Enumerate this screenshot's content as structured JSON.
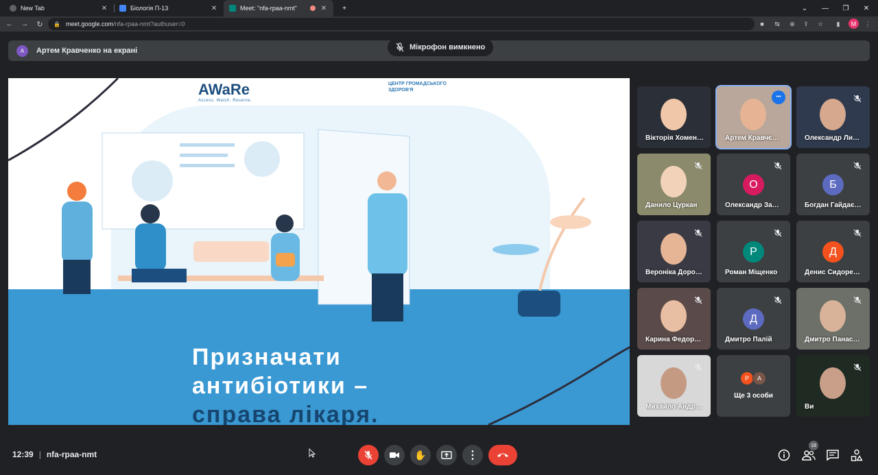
{
  "browser": {
    "tabs": [
      {
        "title": "New Tab",
        "active": false,
        "favicon_color": "#5f6368"
      },
      {
        "title": "Біологія П-13",
        "active": false,
        "favicon_color": "#4285f4"
      },
      {
        "title": "Meet: \"nfa-rpaa-nmt\"",
        "active": true,
        "favicon_color": "#00897b"
      }
    ],
    "url_host": "meet.google.com",
    "url_path": "/nfa-rpaa-nmt?authuser=0",
    "profile_initial": "M"
  },
  "meet": {
    "presenter": {
      "initial": "A",
      "text": "Артем Кравченко на екрані"
    },
    "mic_notice": "Мікрофон вимкнено",
    "slide": {
      "brand": "AWaRe",
      "brand_sub": "Access. Watch. Reserve.",
      "org": "ЦЕНТР ГРОМАДСЬКОГО ЗДОРОВ'Я",
      "caption_line1": "Призначати",
      "caption_line2": "антибіотики –",
      "caption_line3": "справа лікаря."
    },
    "participants": [
      {
        "name": "Вікторія Хомен…",
        "type": "video",
        "muted": false
      },
      {
        "name": "Артем Кравчє…",
        "type": "video",
        "muted": false,
        "selected": true
      },
      {
        "name": "Олександр Ли…",
        "type": "video",
        "muted": true
      },
      {
        "name": "Данило Цуркан",
        "type": "video",
        "muted": true
      },
      {
        "name": "Олександр За…",
        "type": "initial",
        "initial": "О",
        "color": "#d81b60",
        "muted": true
      },
      {
        "name": "Богдан Гайдає…",
        "type": "initial",
        "initial": "Б",
        "color": "#5c6bc0",
        "muted": true
      },
      {
        "name": "Вероніка Доро…",
        "type": "video",
        "muted": true
      },
      {
        "name": "Роман Міщенко",
        "type": "initial",
        "initial": "Р",
        "color": "#00897b",
        "muted": true
      },
      {
        "name": "Денис Сидоре…",
        "type": "initial",
        "initial": "Д",
        "color": "#f4511e",
        "muted": true
      },
      {
        "name": "Карина Федор…",
        "type": "video",
        "muted": true
      },
      {
        "name": "Дмитро Палій",
        "type": "initial",
        "initial": "Д",
        "color": "#5c6bc0",
        "muted": true
      },
      {
        "name": "Дмитро Панас…",
        "type": "video",
        "muted": true
      },
      {
        "name": "Михайло Андр…",
        "type": "video",
        "muted": true
      },
      {
        "name": "Ще 3 особи",
        "type": "more",
        "initials": [
          "Р",
          "А"
        ],
        "colors": [
          "#f4511e",
          "#795548"
        ]
      },
      {
        "name": "Ви",
        "type": "video",
        "muted": true
      }
    ],
    "bottom": {
      "time": "12:39",
      "meeting_code": "nfa-rpaa-nmt",
      "people_count": "18"
    }
  }
}
